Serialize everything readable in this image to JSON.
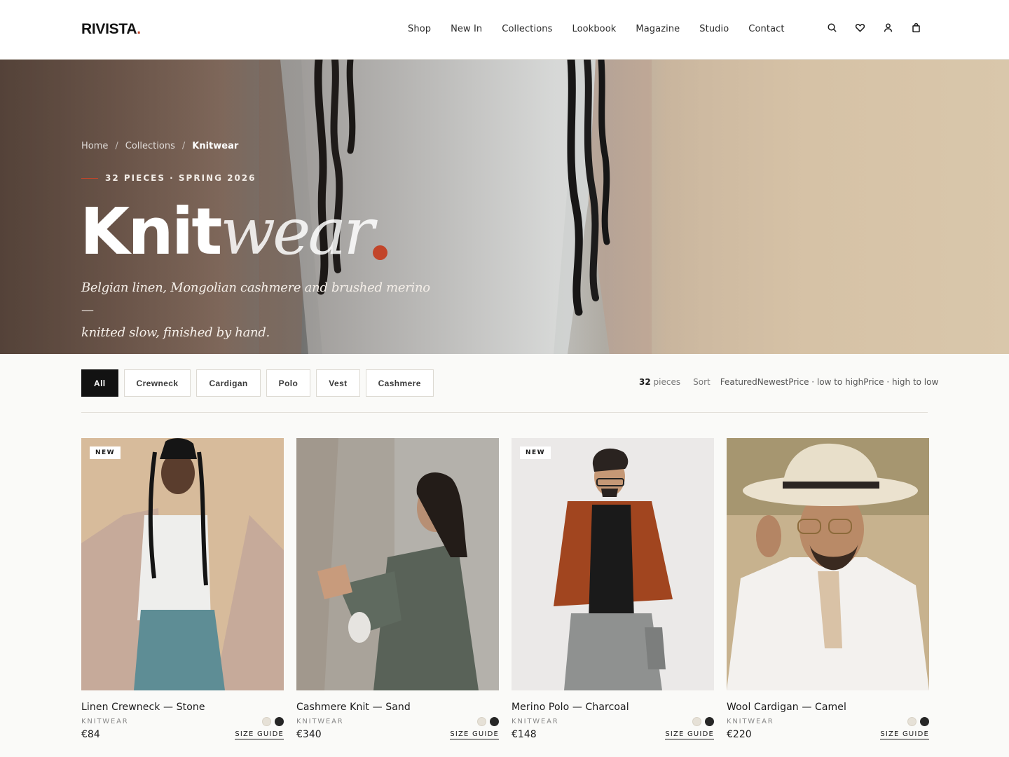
{
  "brand": {
    "name": "RIVISTA",
    "dot": ".",
    "accent": "#c2452a"
  },
  "nav": [
    "Shop",
    "New In",
    "Collections",
    "Lookbook",
    "Magazine",
    "Studio",
    "Contact"
  ],
  "header_icons": [
    "search-icon",
    "heart-icon",
    "user-icon",
    "bag-icon"
  ],
  "breadcrumb": {
    "home": "Home",
    "collections": "Collections",
    "current": "Knitwear",
    "sep": "/"
  },
  "hero": {
    "eyebrow": "32 PIECES · SPRING 2026",
    "title_bold": "Knit",
    "title_italic": "wear",
    "subtitle_line1": "Belgian linen, Mongolian cashmere and brushed merino —",
    "subtitle_line2": "knitted slow, finished by hand."
  },
  "filters": [
    "All",
    "Crewneck",
    "Cardigan",
    "Polo",
    "Vest",
    "Cashmere"
  ],
  "active_filter": "All",
  "results": {
    "count": "32",
    "count_label": "pieces",
    "sort_label": "Sort",
    "sort_options": [
      "Featured",
      "Newest",
      "Price · low to high",
      "Price · high to low"
    ]
  },
  "products": [
    {
      "name": "Linen Crewneck — Stone",
      "category": "KNITWEAR",
      "price": "€84",
      "badge": "NEW",
      "size_guide": "SIZE GUIDE"
    },
    {
      "name": "Cashmere Knit — Sand",
      "category": "KNITWEAR",
      "price": "€340",
      "badge": "",
      "size_guide": "SIZE GUIDE"
    },
    {
      "name": "Merino Polo — Charcoal",
      "category": "KNITWEAR",
      "price": "€148",
      "badge": "NEW",
      "size_guide": "SIZE GUIDE"
    },
    {
      "name": "Wool Cardigan — Camel",
      "category": "KNITWEAR",
      "price": "€220",
      "badge": "",
      "size_guide": "SIZE GUIDE"
    }
  ]
}
